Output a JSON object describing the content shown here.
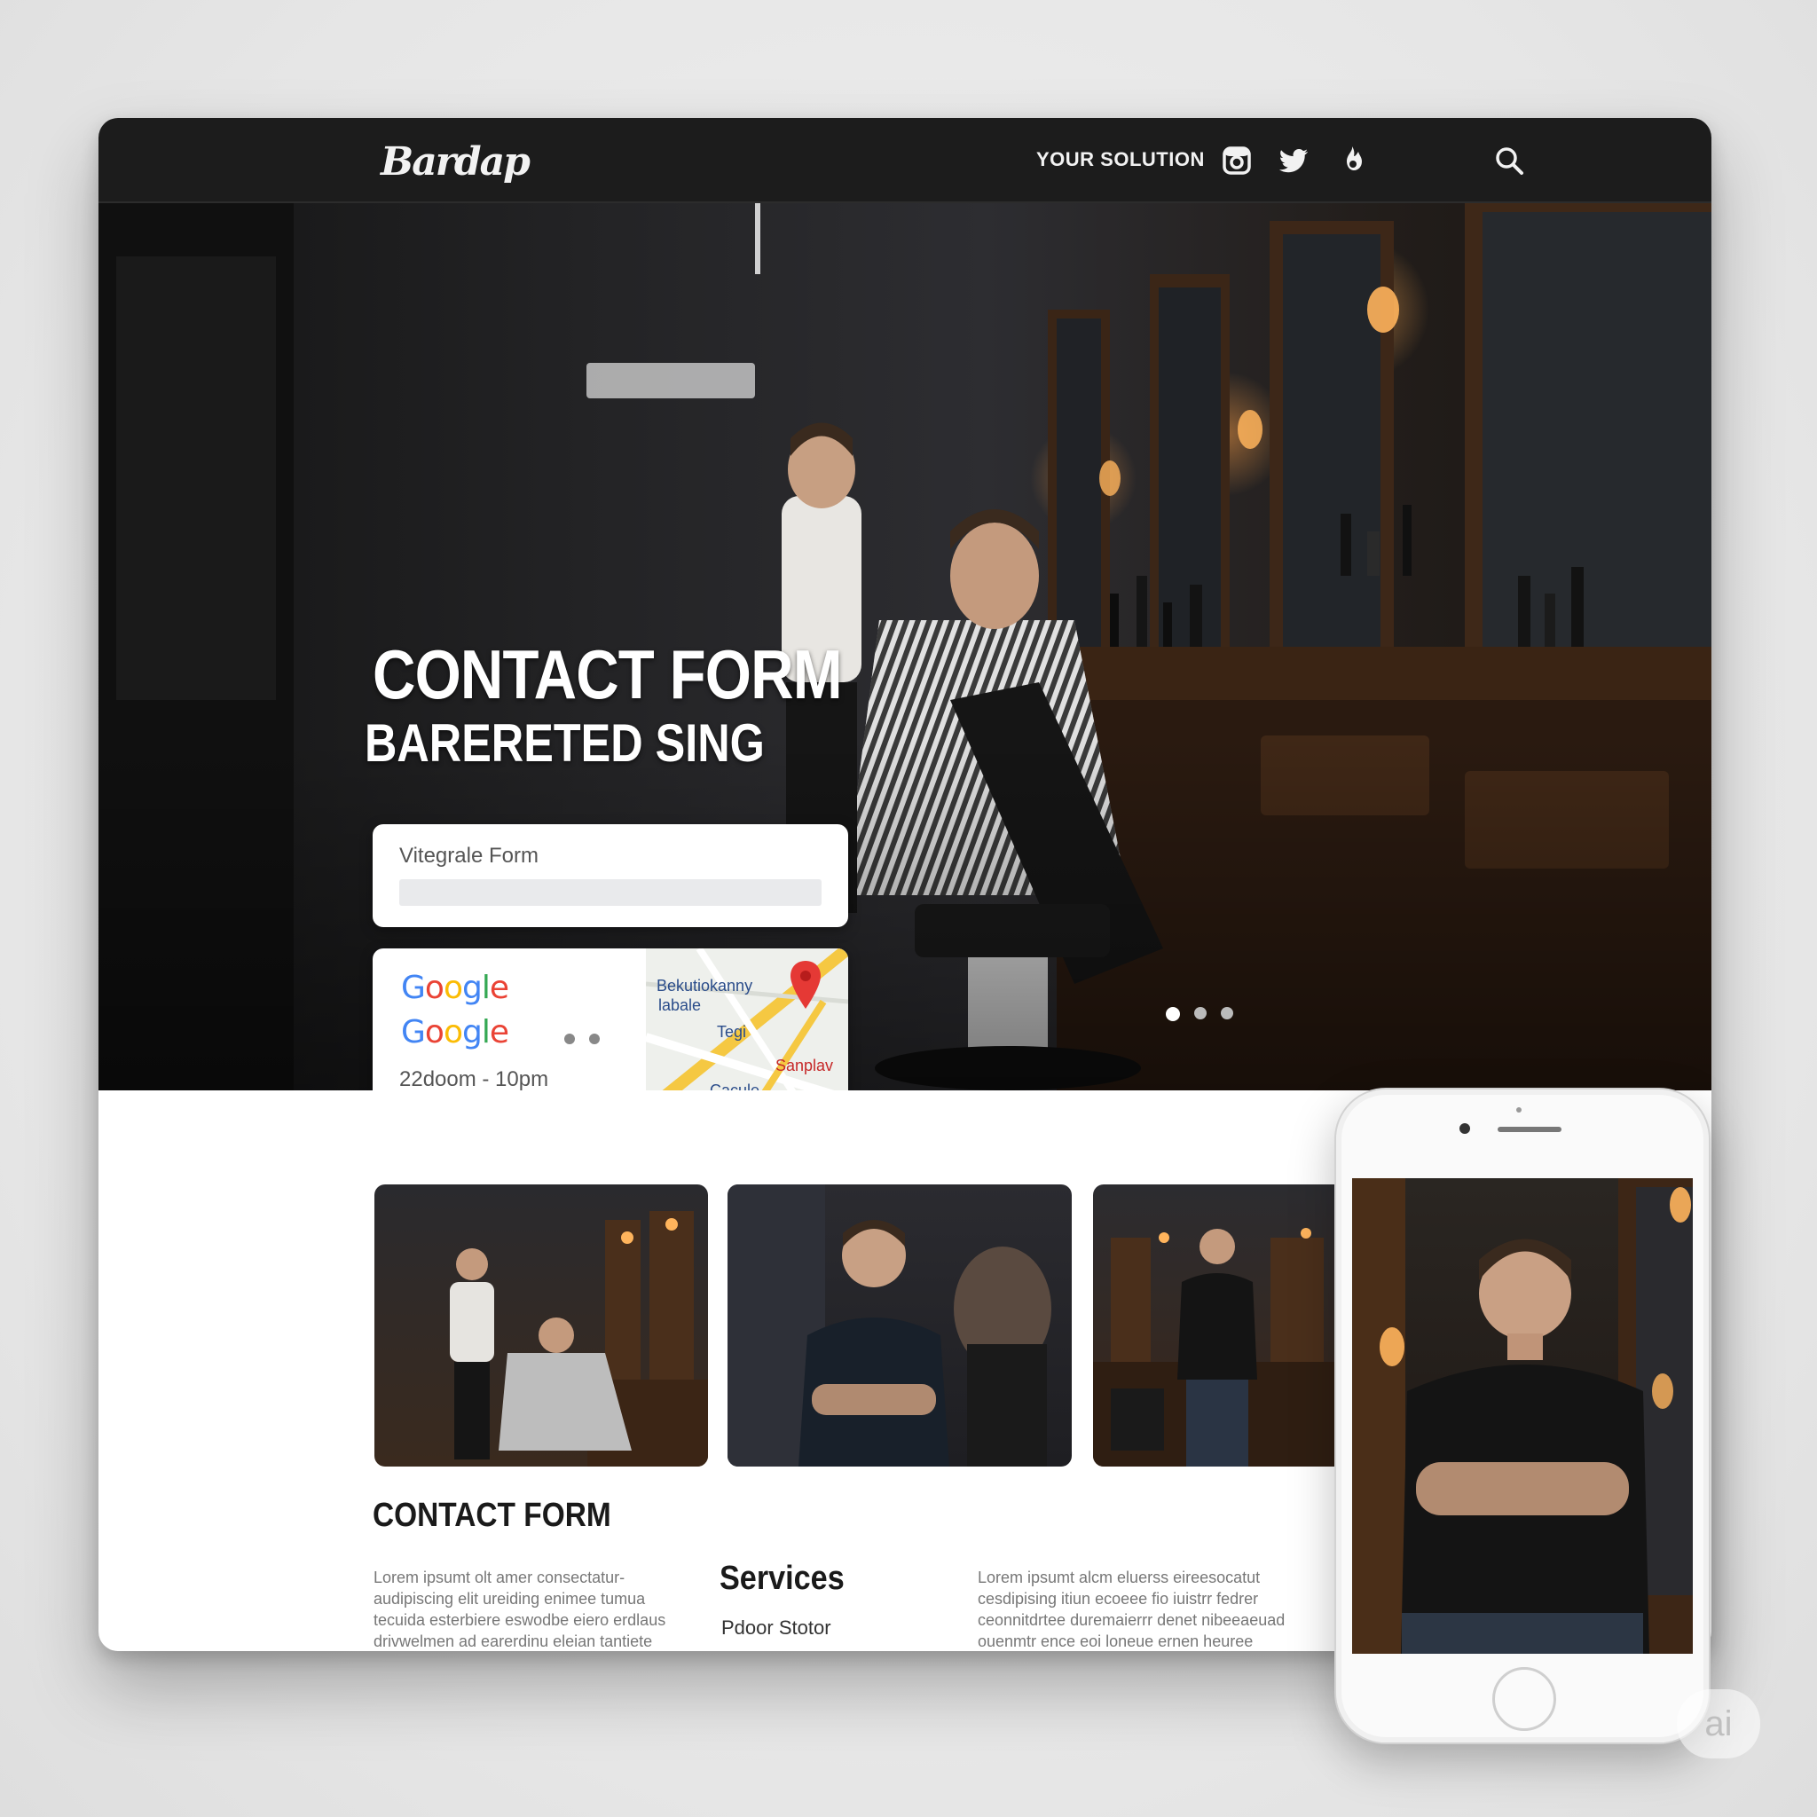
{
  "header": {
    "logo": "Bardap",
    "nav_link": "YOUR SOLUTION",
    "icons": [
      "instagram-icon",
      "twitter-icon",
      "flame-icon",
      "search-icon"
    ]
  },
  "hero": {
    "title": "CONTACT FORM",
    "subtitle": "BARERETED SING",
    "form_label": "Vitegrale Form",
    "info": {
      "brand_primary": "Google",
      "brand_secondary": "Google",
      "hours": "22doom - 10pm",
      "map_labels": [
        "Bekutiokanny",
        "labale",
        "Tegi",
        "Sanplav",
        "Cacule"
      ]
    },
    "slider_dots": 3,
    "slider_dots_right": 3
  },
  "content": {
    "section_title": "CONTACT FORM",
    "lorem_left": [
      "Lorem ipsumt olt amer consectatur-",
      "audipiscing elit ureiding enimee tumua",
      "tecuida esterbiere eswodbe eiero erdlaus",
      "drivwelmen ad earerdinu eleian tantiete"
    ],
    "services_title": "Services",
    "services_item": "Pdoor Stotor",
    "lorem_right": [
      "Lorem ipsumt alcm eluerss eireesocatut",
      "cesdipising itiun ecoeee fio iuistrr fedrer",
      "ceonnitdrtee duremaierrr denet nibeeaeuad",
      "ouenmtr ence eoi loneue ernen heuree"
    ]
  },
  "colors": {
    "topbar": "#1c1c1c",
    "google_blue": "#4285F4",
    "google_red": "#EA4335",
    "google_yellow": "#FBBC05",
    "google_green": "#34A853",
    "map_pin": "#E53935"
  },
  "badge": "ai"
}
